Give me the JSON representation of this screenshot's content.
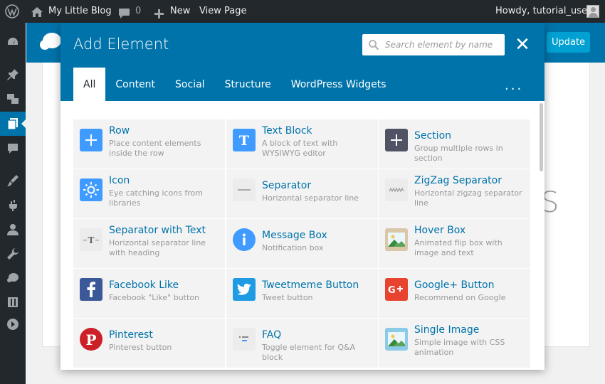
{
  "adminbar": {
    "site_name": "My Little Blog",
    "comments_count": "0",
    "new_label": "New",
    "view_page": "View Page",
    "greeting": "Howdy, tutorial_user"
  },
  "editor": {
    "update_label": "Update",
    "canvas_glyph": "S"
  },
  "modal": {
    "title": "Add Element",
    "search_placeholder": "Search element by name",
    "close_glyph": "✕",
    "tabs": [
      "All",
      "Content",
      "Social",
      "Structure",
      "WordPress Widgets"
    ],
    "active_tab": "All",
    "more_glyph": "..."
  },
  "elements": [
    {
      "title": "Row",
      "desc": "Place content elements inside the row",
      "icon": "plus-icon",
      "bg": "#3f9bff"
    },
    {
      "title": "Text Block",
      "desc": "A block of text with WYSIWYG editor",
      "icon": "text-t-icon",
      "bg": "#3f9bff"
    },
    {
      "title": "Section",
      "desc": "Group multiple rows in section",
      "icon": "plus-icon",
      "bg": "#4f5364"
    },
    {
      "title": "Icon",
      "desc": "Eye catching icons from libraries",
      "icon": "sun-icon",
      "bg": "#3f9bff"
    },
    {
      "title": "Separator",
      "desc": "Horizontal separator line",
      "icon": "separator-line-icon",
      "bg": "#ececec"
    },
    {
      "title": "ZigZag Separator",
      "desc": "Horizontal zigzag separator line",
      "icon": "zigzag-icon",
      "bg": "#ececec"
    },
    {
      "title": "Separator with Text",
      "desc": "Horizontal separator line with heading",
      "icon": "separator-text-icon",
      "bg": "#ececec"
    },
    {
      "title": "Message Box",
      "desc": "Notification box",
      "icon": "info-icon",
      "bg": "#3f9bff"
    },
    {
      "title": "Hover Box",
      "desc": "Animated flip box with image and text",
      "icon": "image-icon",
      "bg": "#d9c7a8"
    },
    {
      "title": "Facebook Like",
      "desc": "Facebook \"Like\" button",
      "icon": "facebook-icon",
      "bg": "#3b5998"
    },
    {
      "title": "Tweetmeme Button",
      "desc": "Tweet button",
      "icon": "twitter-icon",
      "bg": "#1e9be3"
    },
    {
      "title": "Google+ Button",
      "desc": "Recommend on Google",
      "icon": "google-plus-icon",
      "bg": "#e8432e"
    },
    {
      "title": "Pinterest",
      "desc": "Pinterest button",
      "icon": "pinterest-icon",
      "bg": "#cb2027"
    },
    {
      "title": "FAQ",
      "desc": "Toggle element for Q&A block",
      "icon": "faq-icon",
      "bg": "#ececec"
    },
    {
      "title": "Single Image",
      "desc": "Simple image with CSS animation",
      "icon": "image-icon",
      "bg": "#8ccbe8"
    }
  ]
}
